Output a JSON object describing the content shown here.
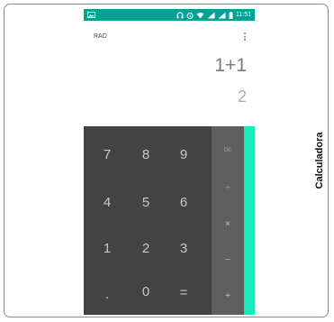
{
  "side_label": "Calculadora",
  "status_bar": {
    "time": "11:51",
    "icons": [
      "image-icon",
      "headphones-icon",
      "alarm-icon",
      "wifi-icon",
      "signal-icon",
      "signal-icon",
      "battery-icon"
    ]
  },
  "display": {
    "mode": "RAD",
    "formula": "1+1",
    "result": "2"
  },
  "keypad": {
    "rows": [
      [
        "7",
        "8",
        "9"
      ],
      [
        "4",
        "5",
        "6"
      ],
      [
        "1",
        "2",
        "3"
      ],
      [
        ".",
        "0",
        "="
      ]
    ]
  },
  "operators": {
    "delete": "DE",
    "divide": "÷",
    "multiply": "×",
    "subtract": "−",
    "add": "+"
  },
  "colors": {
    "status_bar": "#00a294",
    "numpad": "#434343",
    "operators": "#5e5e5e",
    "accent": "#1de9b6"
  }
}
